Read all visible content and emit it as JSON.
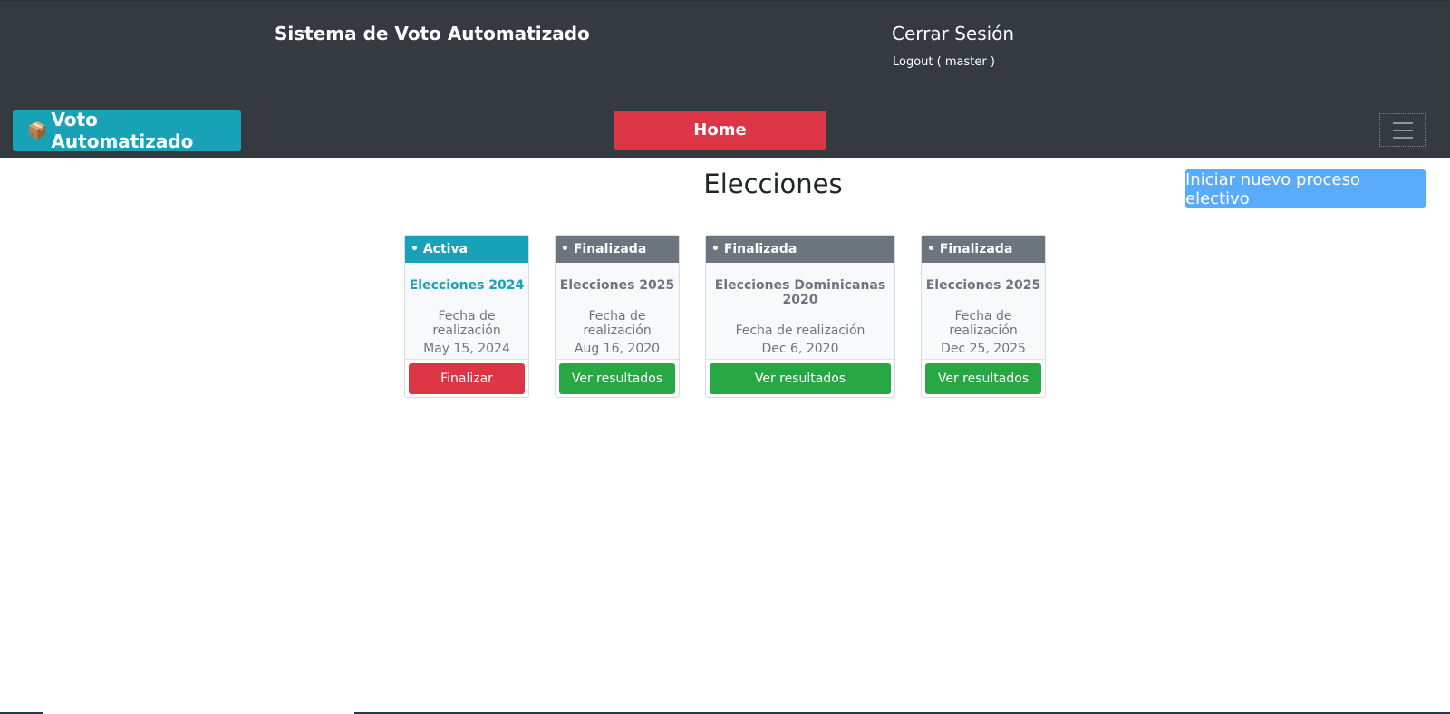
{
  "header": {
    "site_title": "Sistema de Voto Automatizado",
    "logout_title": "Cerrar Sesión",
    "logout_sub": "Logout ( master )"
  },
  "navbar": {
    "brand_icon": "📦",
    "brand_label": "Voto Automatizado",
    "home_label": "Home",
    "toggler_icon": "hamburger-icon"
  },
  "main": {
    "heading": "Elecciones",
    "new_process_label": "Iniciar nuevo proceso electivo"
  },
  "cards": [
    {
      "status": "• Activa",
      "title": "Elecciones 2024",
      "date_label": "Fecha de realización",
      "date": "May 15, 2024",
      "action": "Finalizar"
    },
    {
      "status": "• Finalizada",
      "title": "Elecciones 2025",
      "date_label": "Fecha de realización",
      "date": "Aug 16, 2020",
      "action": "Ver resultados"
    },
    {
      "status": "• Finalizada",
      "title": "Elecciones Dominicanas 2020",
      "date_label": "Fecha de realización",
      "date": "Dec 6, 2020",
      "action": "Ver resultados"
    },
    {
      "status": "• Finalizada",
      "title": "Elecciones 2025",
      "date_label": "Fecha de realización",
      "date": "Dec 25, 2025",
      "action": "Ver resultados"
    }
  ],
  "colors": {
    "header_bg": "#343a40",
    "info": "#17a2b8",
    "danger": "#dc3545",
    "success": "#28a745",
    "secondary": "#6c757d",
    "primary_light": "#5aabfb"
  }
}
